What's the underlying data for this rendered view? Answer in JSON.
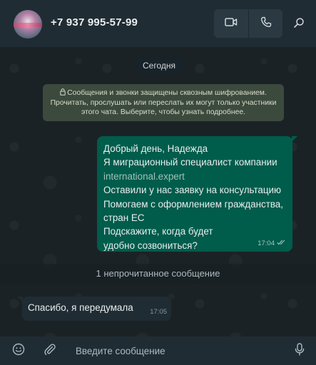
{
  "header": {
    "contact_name": "+7 937 995-57-99",
    "icons": [
      "avatar",
      "video-call-icon",
      "voice-call-icon",
      "search-icon"
    ]
  },
  "chat": {
    "date_label": "Сегодня",
    "encryption_notice": {
      "line1": "Сообщения и звонки защищены сквозным шифрованием.",
      "line2": "Прочитать, прослушать или переслать их могут только участники",
      "line3": "этого чата. Выберите, чтобы узнать подробнее."
    },
    "outgoing_message": {
      "lines": [
        "Добрый день, Надежда",
        "Я миграционный специалист компании",
        "international.expert",
        "Оставили у нас заявку на консультацию",
        "Помогаем с оформлением гражданства,",
        "стран ЕС",
        "Подскажите, когда будет",
        "удобно созвониться?"
      ],
      "time": "17:04",
      "status": "delivered-double-check"
    },
    "unread_separator": "1 непрочитанное сообщение",
    "incoming_message": {
      "text": "Спасибо, я передумала",
      "time": "17:05"
    }
  },
  "footer": {
    "placeholder": "Введите сообщение",
    "icons": [
      "emoji-icon",
      "attach-icon",
      "microphone-icon"
    ]
  },
  "colors": {
    "header_bg": "#202c33",
    "outgoing_bubble": "#005c4b",
    "incoming_bubble": "#202c33",
    "encryption_notice_bg": "#3c4a3e"
  }
}
